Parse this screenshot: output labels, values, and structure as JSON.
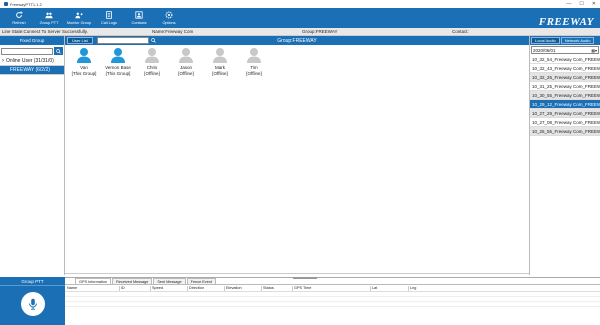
{
  "window": {
    "title": "FreewayPTT1.1.2",
    "minimize": "—",
    "maximize": "☐",
    "close": "✕"
  },
  "toolbar": {
    "buttons": [
      {
        "label": "Refresh",
        "icon": "refresh-icon"
      },
      {
        "label": "Group PTT",
        "icon": "group-ptt-icon"
      },
      {
        "label": "Monitor Group",
        "icon": "monitor-group-icon"
      },
      {
        "label": "Call Logs",
        "icon": "call-logs-icon"
      },
      {
        "label": "Contacts",
        "icon": "contacts-icon"
      },
      {
        "label": "Options",
        "icon": "options-icon"
      }
    ]
  },
  "logo": {
    "brand": "FREEWAY",
    "sub": "COMMUNICATIONS"
  },
  "status": {
    "line_state": "Line State:Connect To Server Successfully.",
    "name": "Name:Freeway Com",
    "group": "Group:FREEWAY",
    "contact": "Contact:"
  },
  "left": {
    "header": "Fixed Group",
    "tree": [
      {
        "label": "Online User (31/31/0)",
        "selected": false
      },
      {
        "label": "FREEWAY (6/2/2)",
        "selected": true
      }
    ]
  },
  "center": {
    "tab": "User List",
    "group_title": "Group:FREEWAY",
    "users": [
      {
        "name": "Van",
        "status": "[This Group]",
        "online": true
      },
      {
        "name": "Vernon Base",
        "status": "[This Group]",
        "online": true
      },
      {
        "name": "Chris",
        "status": "[Offline]",
        "online": false
      },
      {
        "name": "Jason",
        "status": "[Offline]",
        "online": false
      },
      {
        "name": "Mark",
        "status": "[Offline]",
        "online": false
      },
      {
        "name": "Tim",
        "status": "[Offline]",
        "online": false
      }
    ]
  },
  "right": {
    "tabs": [
      "Local Audio",
      "Network Audio"
    ],
    "active_tab": "Local Audio",
    "date": "2020/06/01",
    "records": [
      "10_32_54_Freeway Com_FREEWAY",
      "10_32_43_Freeway Com_FREEWAY",
      "10_32_26_Freeway Com_FREEWAY",
      "10_31_25_Freeway Com_FREEWAY",
      "10_30_55_Freeway Com_FREEWAY",
      "10_29_12_Freeway Com_FREEWAY",
      "10_27_29_Freeway Com_FREEWAY",
      "10_27_08_Freeway Com_FREEWAY",
      "10_26_55_Freeway Com_FREEWAY"
    ],
    "selected_index": 5
  },
  "bottom_left": {
    "title": "Group PTT"
  },
  "bottom": {
    "tabs": [
      "GPS Information",
      "Received Message",
      "Sent Message",
      "Fence Event"
    ],
    "active_tab": "GPS Information",
    "columns": [
      "Name",
      "ID",
      "Speed",
      "Direction",
      "Elevation",
      "Status",
      "GPS Time",
      "Lat",
      "Lng"
    ]
  },
  "colors": {
    "primary": "#1b6fb5",
    "online_user": "#2196d8",
    "offline_user": "#c8c8c8"
  }
}
